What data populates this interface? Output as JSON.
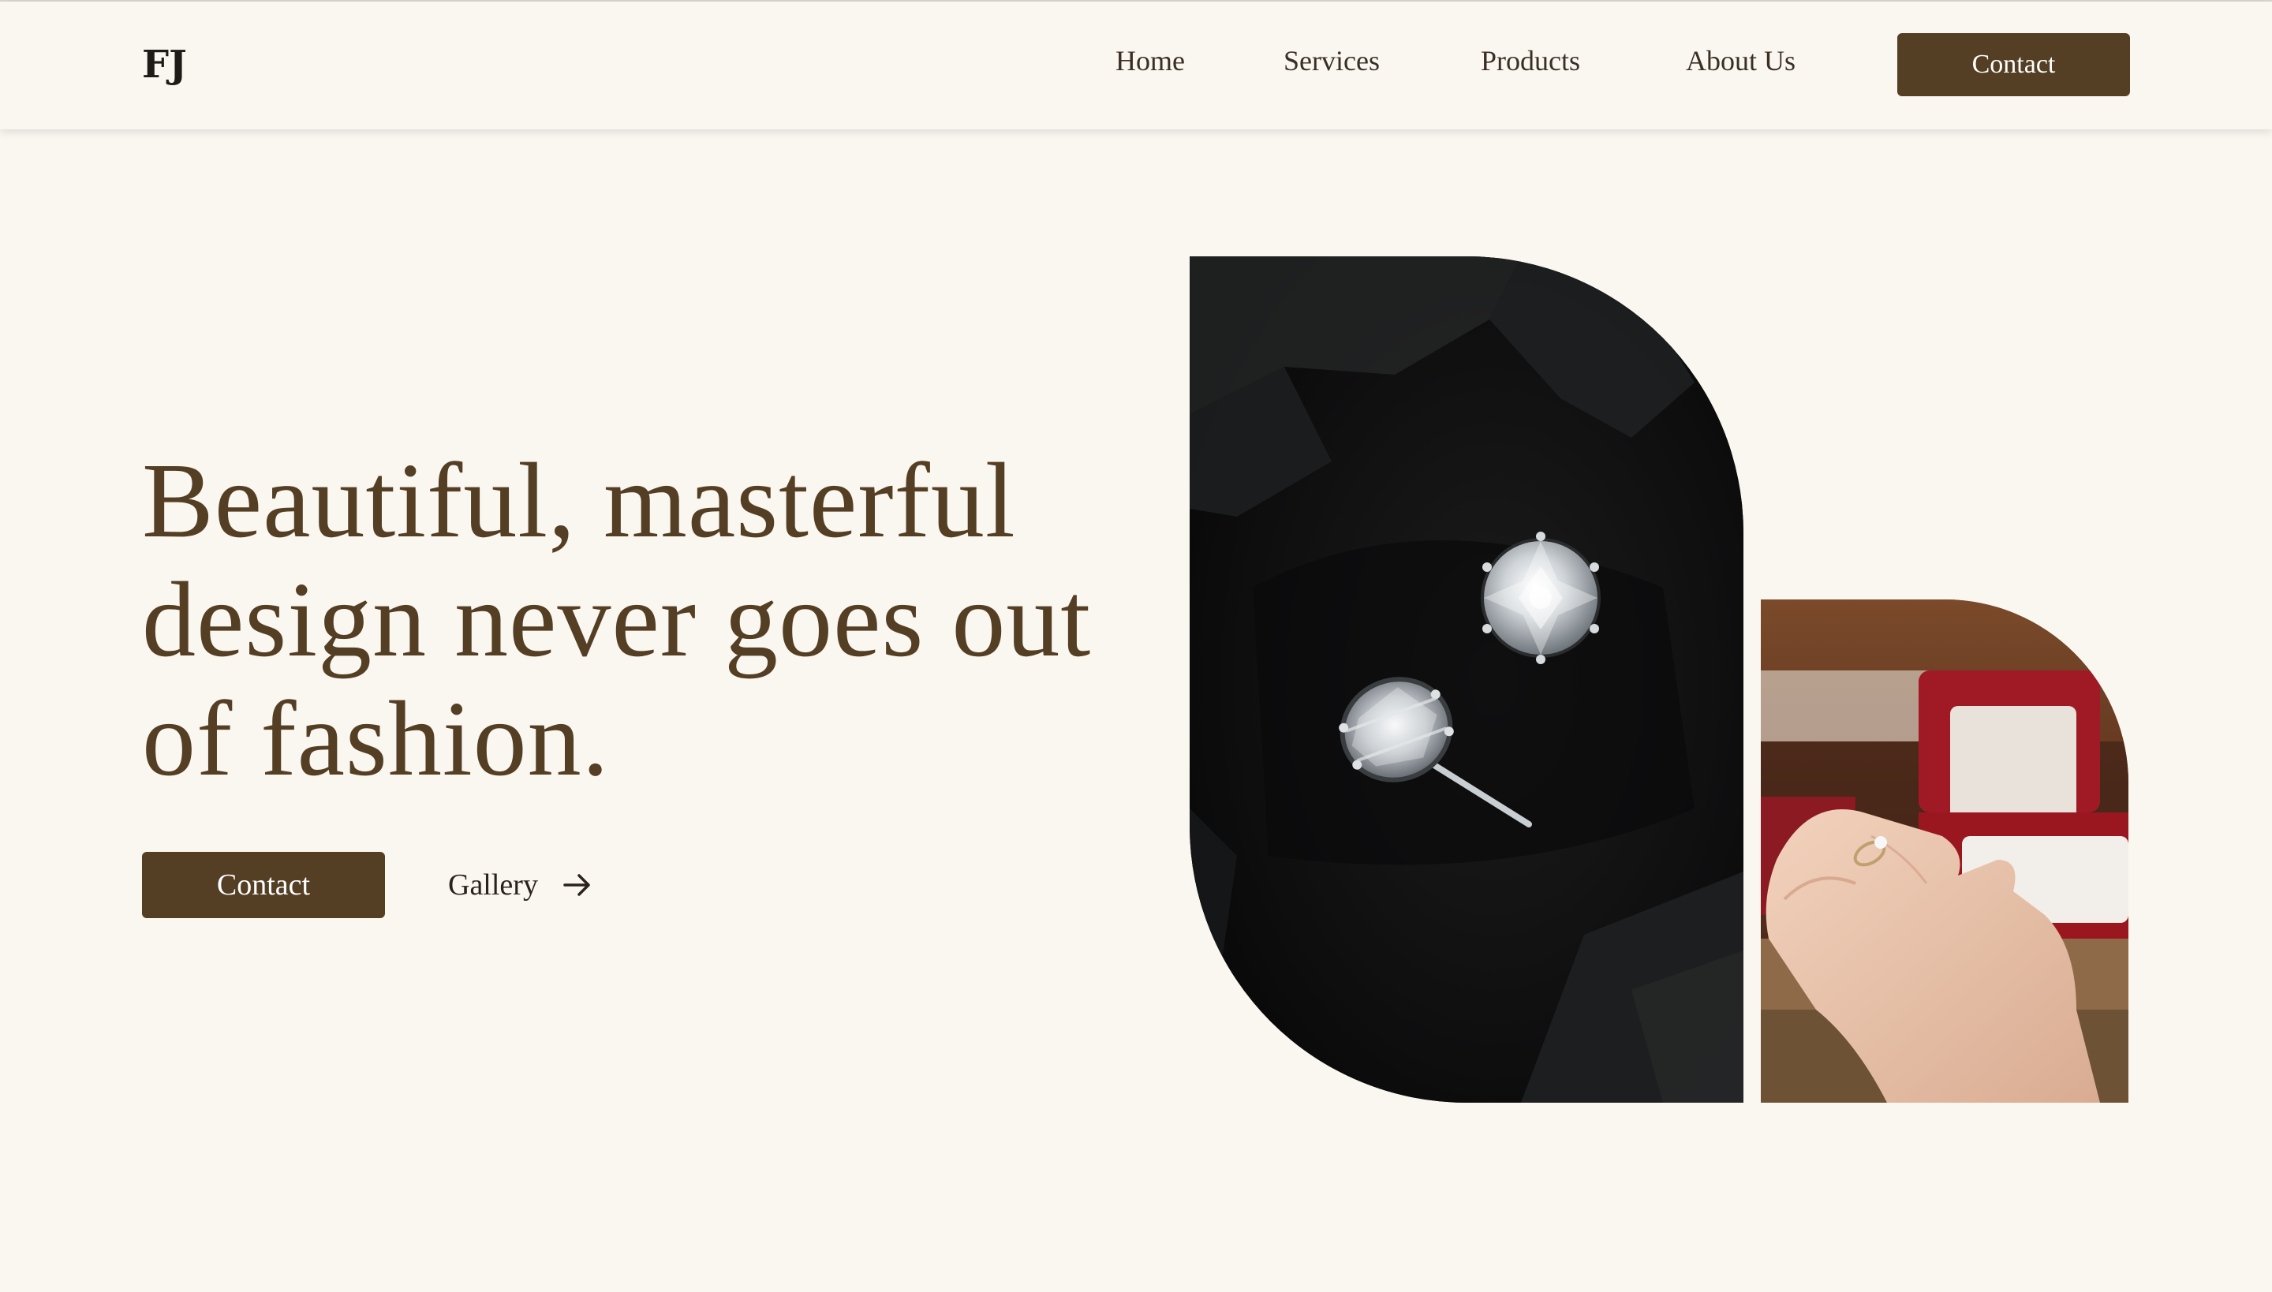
{
  "header": {
    "logo": "FJ",
    "nav": [
      {
        "label": "Home"
      },
      {
        "label": "Services"
      },
      {
        "label": "Products"
      },
      {
        "label": "About Us"
      }
    ],
    "contact_label": "Contact"
  },
  "hero": {
    "headline": "Beautiful, masterful design never goes out of fashion.",
    "contact_label": "Contact",
    "gallery_label": "Gallery",
    "gallery_icon": "arrow-right-icon"
  },
  "images": {
    "large": "diamond-stud-earrings-on-black-rock",
    "small": "hand-with-ring-over-red-jewelry-box"
  },
  "colors": {
    "background": "#faf6f0",
    "accent": "#543f24",
    "text_dark": "#1e1a16"
  }
}
